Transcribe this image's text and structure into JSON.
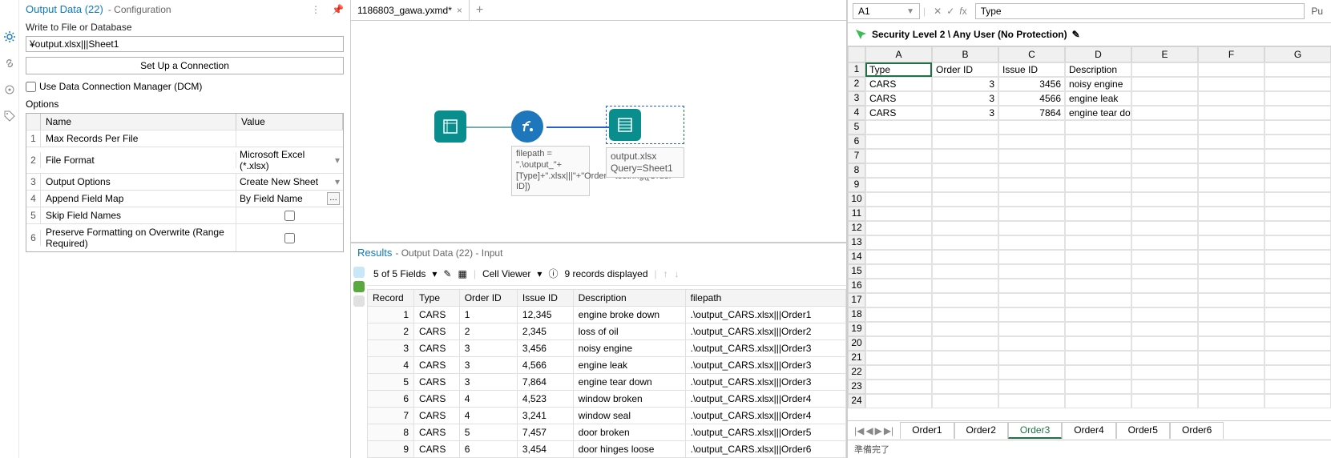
{
  "config": {
    "title": "Output Data (22)",
    "subtitle": "- Configuration",
    "write_label": "Write to File or Database",
    "file_value": "¥output.xlsx|||Sheet1",
    "connection_btn": "Set Up a Connection",
    "dcm_label": "Use Data Connection Manager (DCM)",
    "options_label": "Options",
    "col_name": "Name",
    "col_value": "Value",
    "rows": [
      {
        "i": "1",
        "name": "Max Records Per File",
        "value": ""
      },
      {
        "i": "2",
        "name": "File Format",
        "value": "Microsoft Excel (*.xlsx)"
      },
      {
        "i": "3",
        "name": "Output Options",
        "value": "Create New Sheet"
      },
      {
        "i": "4",
        "name": "Append Field Map",
        "value": "By Field Name"
      },
      {
        "i": "5",
        "name": "Skip Field Names",
        "value": "checkbox"
      },
      {
        "i": "6",
        "name": "Preserve Formatting on Overwrite (Range Required)",
        "value": "checkbox"
      }
    ]
  },
  "tabs": {
    "workflow_name": "1186803_gawa.yxmd*"
  },
  "canvas": {
    "formula_label": "filepath = \".\\output_\"+[Type]+\".xlsx|||\"+\"Order\"+tostring([Order ID])",
    "output_label_1": "output.xlsx",
    "output_label_2": "Query=Sheet1"
  },
  "results": {
    "title": "Results",
    "sub": "- Output Data (22) - Input",
    "fields_text": "5 of 5 Fields",
    "cell_viewer": "Cell Viewer",
    "records_text": "9 records displayed",
    "columns": [
      "Record",
      "Type",
      "Order ID",
      "Issue ID",
      "Description",
      "filepath"
    ],
    "rows": [
      [
        "1",
        "CARS",
        "1",
        "12,345",
        "engine broke down",
        ".\\output_CARS.xlsx|||Order1"
      ],
      [
        "2",
        "CARS",
        "2",
        "2,345",
        "loss of oil",
        ".\\output_CARS.xlsx|||Order2"
      ],
      [
        "3",
        "CARS",
        "3",
        "3,456",
        "noisy engine",
        ".\\output_CARS.xlsx|||Order3"
      ],
      [
        "4",
        "CARS",
        "3",
        "4,566",
        "engine leak",
        ".\\output_CARS.xlsx|||Order3"
      ],
      [
        "5",
        "CARS",
        "3",
        "7,864",
        "engine tear down",
        ".\\output_CARS.xlsx|||Order3"
      ],
      [
        "6",
        "CARS",
        "4",
        "4,523",
        "window broken",
        ".\\output_CARS.xlsx|||Order4"
      ],
      [
        "7",
        "CARS",
        "4",
        "3,241",
        "window seal",
        ".\\output_CARS.xlsx|||Order4"
      ],
      [
        "8",
        "CARS",
        "5",
        "7,457",
        "door broken",
        ".\\output_CARS.xlsx|||Order5"
      ],
      [
        "9",
        "CARS",
        "6",
        "3,454",
        "door hinges loose",
        ".\\output_CARS.xlsx|||Order6"
      ]
    ]
  },
  "excel": {
    "namebox": "A1",
    "fx_value": "Type",
    "security": "Security Level 2 \\ Any User (No Protection)",
    "pu_text": "Pu",
    "cols": [
      "A",
      "B",
      "C",
      "D",
      "E",
      "F",
      "G"
    ],
    "row_numbers": [
      "1",
      "2",
      "3",
      "4",
      "5",
      "6",
      "7",
      "8",
      "9",
      "10",
      "11",
      "12",
      "13",
      "14",
      "15",
      "16",
      "17",
      "18",
      "19",
      "20",
      "21",
      "22",
      "23",
      "24"
    ],
    "data": [
      [
        "Type",
        "Order ID",
        "Issue ID",
        "Description",
        "",
        "",
        ""
      ],
      [
        "CARS",
        "3",
        "3456",
        "noisy engine",
        "",
        "",
        ""
      ],
      [
        "CARS",
        "3",
        "4566",
        "engine leak",
        "",
        "",
        ""
      ],
      [
        "CARS",
        "3",
        "7864",
        "engine tear down",
        "",
        "",
        ""
      ]
    ],
    "sheet_tabs": [
      "Order1",
      "Order2",
      "Order3",
      "Order4",
      "Order5",
      "Order6"
    ],
    "active_tab": "Order3",
    "status": "準備完了"
  }
}
